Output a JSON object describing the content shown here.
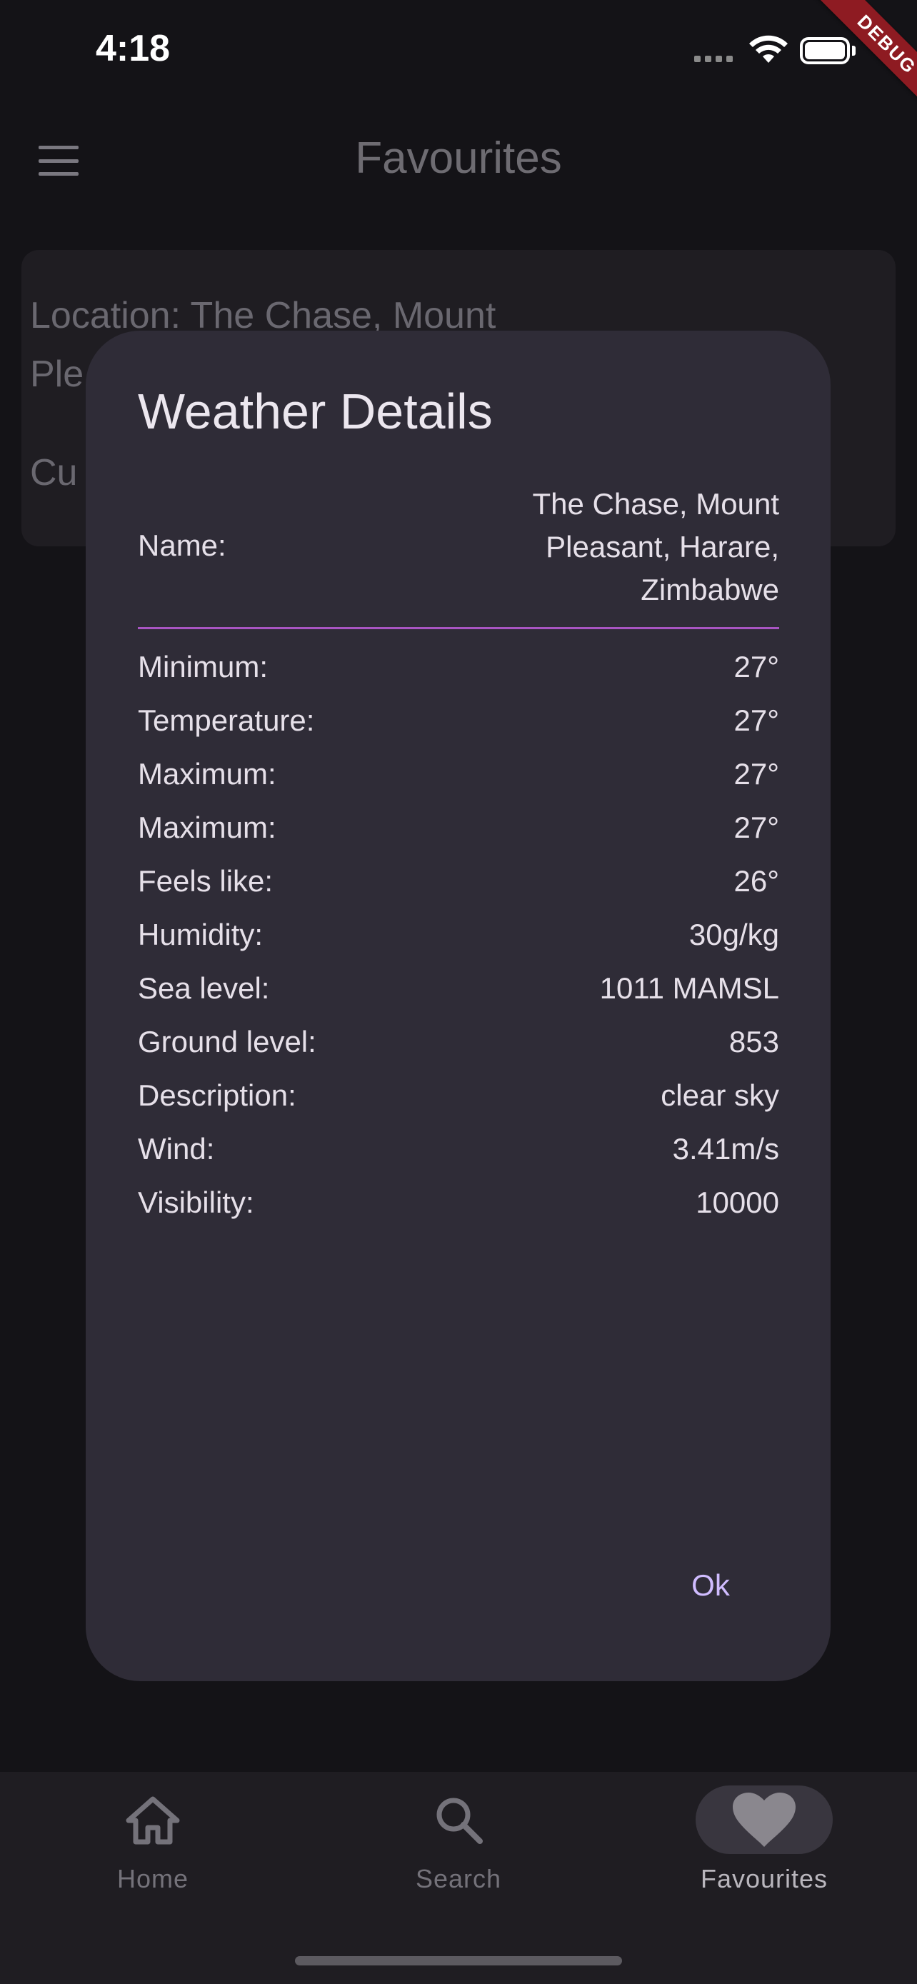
{
  "status_bar": {
    "time": "4:18"
  },
  "debug_ribbon": "DEBUG",
  "app_bar": {
    "title": "Favourites",
    "menu_icon": "menu-icon"
  },
  "background_card": {
    "line1": "Location: The Chase, Mount",
    "line2": "Ple",
    "line3": "Cu"
  },
  "dialog": {
    "title": "Weather Details",
    "name_label": "Name:",
    "name_value": "The Chase, Mount Pleasant, Harare, Zimbabwe",
    "rows": [
      {
        "label": "Minimum:",
        "value": "27°"
      },
      {
        "label": "Temperature:",
        "value": "27°"
      },
      {
        "label": "Maximum:",
        "value": "27°"
      },
      {
        "label": "Maximum:",
        "value": "27°"
      },
      {
        "label": "Feels like:",
        "value": "26°"
      },
      {
        "label": "Humidity:",
        "value": "30g/kg"
      },
      {
        "label": "Sea level:",
        "value": "1011 MAMSL"
      },
      {
        "label": "Ground level:",
        "value": "853"
      },
      {
        "label": "Description:",
        "value": "clear sky"
      },
      {
        "label": "Wind:",
        "value": "3.41m/s"
      },
      {
        "label": "Visibility:",
        "value": "10000"
      }
    ],
    "ok_label": "Ok",
    "accent_color": "#d0bcff",
    "divider_color": "#a855c2"
  },
  "bottom_nav": {
    "items": [
      {
        "label": "Home",
        "icon": "home-icon",
        "active": false
      },
      {
        "label": "Search",
        "icon": "search-icon",
        "active": false
      },
      {
        "label": "Favourites",
        "icon": "heart-icon",
        "active": true
      }
    ]
  }
}
